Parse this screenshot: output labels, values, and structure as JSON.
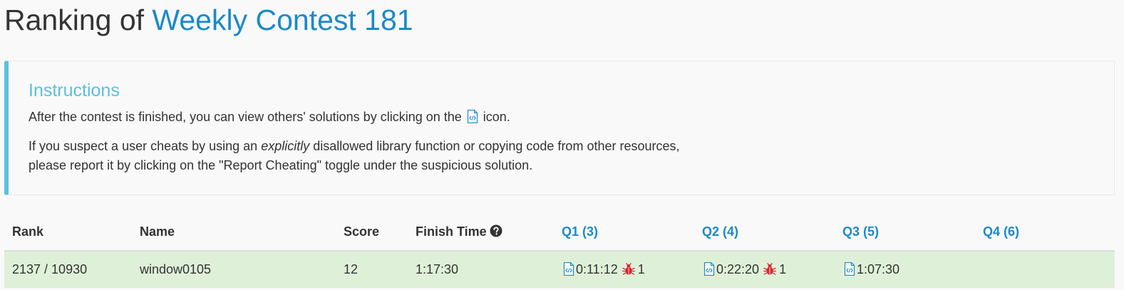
{
  "header": {
    "title_prefix": "Ranking of ",
    "contest_name": "Weekly Contest 181"
  },
  "instructions": {
    "title": "Instructions",
    "line1_before": "After the contest is finished, you can view others' solutions by clicking on the",
    "line1_after": "icon.",
    "line2_before": "If you suspect a user cheats by using an",
    "line2_emphasis": "explicitly",
    "line2_after": "disallowed library function or copying code from other resources,",
    "line3": "please report it by clicking on the \"Report Cheating\" toggle under the suspicious solution."
  },
  "table": {
    "headers": {
      "rank": "Rank",
      "name": "Name",
      "score": "Score",
      "finish_time": "Finish Time",
      "q1": "Q1 (3)",
      "q2": "Q2 (4)",
      "q3": "Q3 (5)",
      "q4": "Q4 (6)"
    },
    "rows": [
      {
        "rank": "2137 / 10930",
        "name": "window0105",
        "score": "12",
        "finish_time": "1:17:30",
        "q1": {
          "time": "0:11:12",
          "bugs": "1"
        },
        "q2": {
          "time": "0:22:20",
          "bugs": "1"
        },
        "q3": {
          "time": "1:07:30"
        },
        "q4": {}
      }
    ]
  },
  "icons": {
    "code": "code-file-icon",
    "help": "question-circle-icon",
    "bug": "bug-icon"
  },
  "colors": {
    "link": "#1a8ac9",
    "instructions_accent": "#5bc0de",
    "row_highlight": "#dff0d8",
    "bug": "#d9232d"
  }
}
